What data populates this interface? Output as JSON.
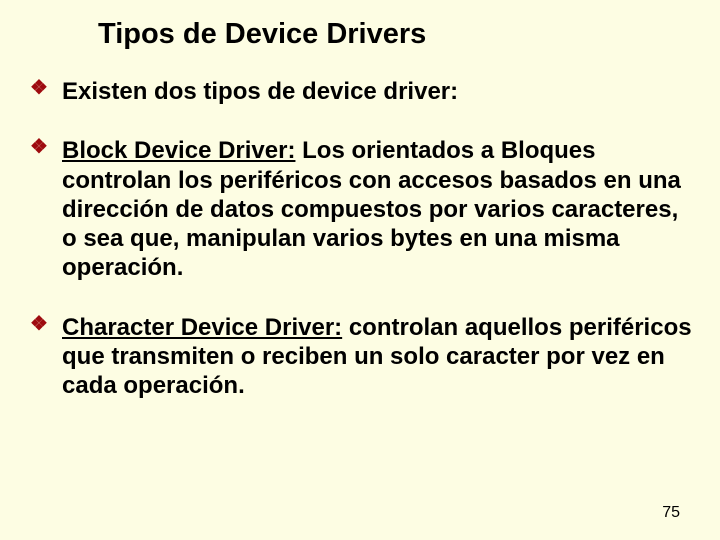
{
  "title": "Tipos de Device Drivers",
  "bullets": {
    "b1": {
      "text": "Existen dos tipos de device driver:"
    },
    "b2": {
      "term": "Block Device  Driver:",
      "text": " Los orientados a Bloques controlan los periféricos con accesos basados en una dirección de datos compuestos por varios caracteres, o sea que, manipulan varios bytes en una misma operación."
    },
    "b3": {
      "term": "Character Device  Driver:",
      "text": " controlan aquellos periféricos que transmiten o reciben un solo caracter por vez en cada operación."
    }
  },
  "page_number": "75",
  "icon_glyph": "❖"
}
